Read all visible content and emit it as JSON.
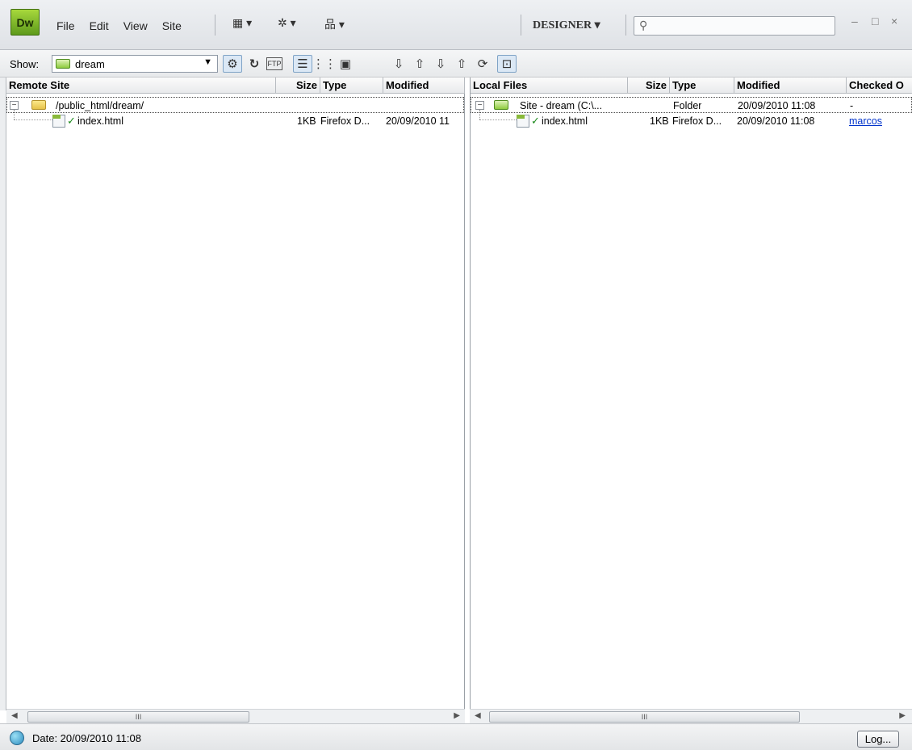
{
  "app": {
    "logo_text": "Dw",
    "menu": [
      "File",
      "Edit",
      "View",
      "Site"
    ],
    "workspace": "DESIGNER",
    "search": {
      "value": ""
    }
  },
  "toolbar": {
    "show_label": "Show:",
    "site_select": "dream"
  },
  "remote": {
    "columns": [
      "Remote Site",
      "Size",
      "Type",
      "Modified"
    ],
    "root": {
      "name": "/public_html/dream/"
    },
    "files": [
      {
        "name": "index.html",
        "size": "1KB",
        "type": "Firefox D...",
        "modified": "20/09/2010 11"
      }
    ]
  },
  "local": {
    "columns": [
      "Local Files",
      "Size",
      "Type",
      "Modified",
      "Checked O"
    ],
    "root": {
      "name": "Site - dream (C:\\...",
      "type": "Folder",
      "modified": "20/09/2010 11:08",
      "checked": "-"
    },
    "files": [
      {
        "name": "index.html",
        "size": "1KB",
        "type": "Firefox D...",
        "modified": "20/09/2010 11:08",
        "checked": "marcos"
      }
    ]
  },
  "status": {
    "text": "Date: 20/09/2010 11:08",
    "log_button": "Log..."
  },
  "scroll_grip": "III",
  "colors": {
    "logo": "#7cbf2a",
    "link": "#0033cc",
    "check": "#1c8a1c"
  }
}
